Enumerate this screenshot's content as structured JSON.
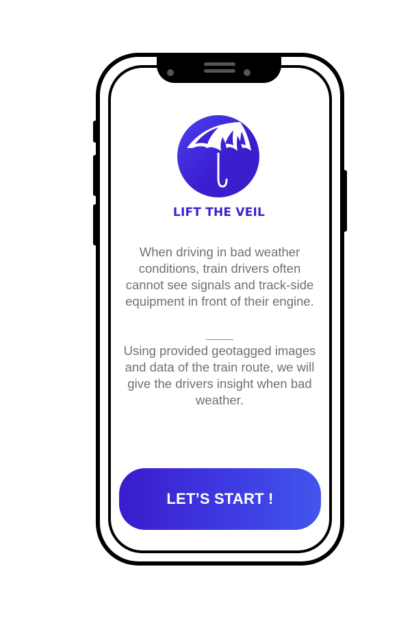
{
  "app": {
    "brand_name": "LIFT THE VEIL",
    "logo_icon": "umbrella-icon"
  },
  "content": {
    "intro_text": "When driving in bad weather conditions, train drivers often cannot see signals and track-side equipment in front of their engine.",
    "detail_text": "Using provided geotagged images and data of the train route, we will give the drivers insight when bad weather."
  },
  "actions": {
    "start_label": "LET’S START !"
  },
  "colors": {
    "brand": "#3c1fc9",
    "button_start": "#3a1ccc",
    "button_end": "#4256ec",
    "body_text": "#707070"
  }
}
